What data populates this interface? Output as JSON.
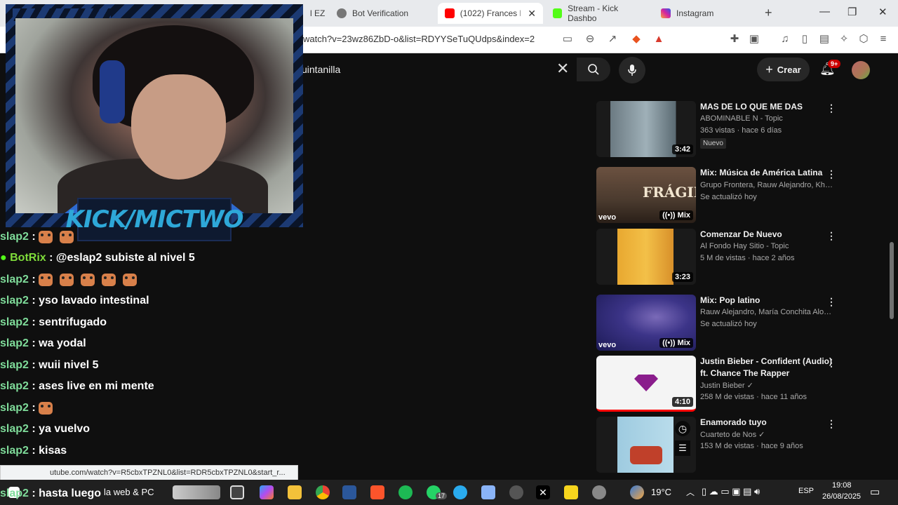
{
  "browser": {
    "tabs": [
      {
        "label": "l EZ"
      },
      {
        "label": "Bot Verification"
      },
      {
        "label": "(1022) Frances Li"
      },
      {
        "label": "Stream - Kick Dashbo"
      },
      {
        "label": "Instagram"
      }
    ],
    "url": "watch?v=23wz86ZbD-o&list=RDYYSeTuQUdps&index=2"
  },
  "youtube": {
    "search_value": "uintanilla",
    "create_label": "Crear",
    "notif_count": "9+",
    "recommendations": [
      {
        "title": "MAS DE LO QUE ME DAS",
        "channel": "ABOMINABLE N - Topic",
        "meta": "363 vistas · hace 6 días",
        "duration": "3:42",
        "badge": "Nuevo"
      },
      {
        "title": "Mix: Música de América Latina",
        "channel": "Grupo Frontera, Rauw Alejandro, Khea y ...",
        "meta": "Se actualizó hoy",
        "duration": "Mix",
        "thumb_text": "FRÁGIL"
      },
      {
        "title": "Comenzar De Nuevo",
        "channel": "Al Fondo Hay Sitio - Topic",
        "meta": "5 M de vistas · hace 2 años",
        "duration": "3:23"
      },
      {
        "title": "Mix: Pop latino",
        "channel": "Rauw Alejandro, María Conchita Alonso, ...",
        "meta": "Se actualizó hoy",
        "duration": "Mix"
      },
      {
        "title": "Justin Bieber - Confident (Audio) ft. Chance The Rapper",
        "channel": "Justin Bieber",
        "meta": "258 M de vistas · hace 11 años",
        "duration": "4:10"
      },
      {
        "title": "Enamorado tuyo",
        "channel": "Cuarteto de Nos",
        "meta": "153 M de vistas · hace 9 años"
      }
    ]
  },
  "overlay": {
    "kick_label": "KICK/MICTWO",
    "chat": [
      {
        "user": "slap2",
        "text": ""
      },
      {
        "user": "BotRix",
        "text": ": @eslap2 subiste al nivel 5"
      },
      {
        "user": "slap2",
        "text": ""
      },
      {
        "user": "slap2",
        "text": ": yso lavado intestinal"
      },
      {
        "user": "slap2",
        "text": ": sentrifugado"
      },
      {
        "user": "slap2",
        "text": ": wa yodal"
      },
      {
        "user": "slap2",
        "text": ": wuii nivel 5"
      },
      {
        "user": "slap2",
        "text": ": ases live en mi mente"
      },
      {
        "user": "slap2",
        "text": ""
      },
      {
        "user": "slap2",
        "text": ": ya vuelvo"
      },
      {
        "user": "slap2",
        "text": ": kisas"
      },
      {
        "user": "slap2",
        "text": ": hasta luego"
      }
    ],
    "status_url": "utube.com/watch?v=R5cbxTPZNL0&list=RDR5cbxTPZNL0&start_r..."
  },
  "taskbar": {
    "search_text": "la web & PC",
    "whatsapp_count": "17",
    "weather": "19°C",
    "lang": "ESP",
    "time": "19:08",
    "date": "26/08/2025"
  }
}
